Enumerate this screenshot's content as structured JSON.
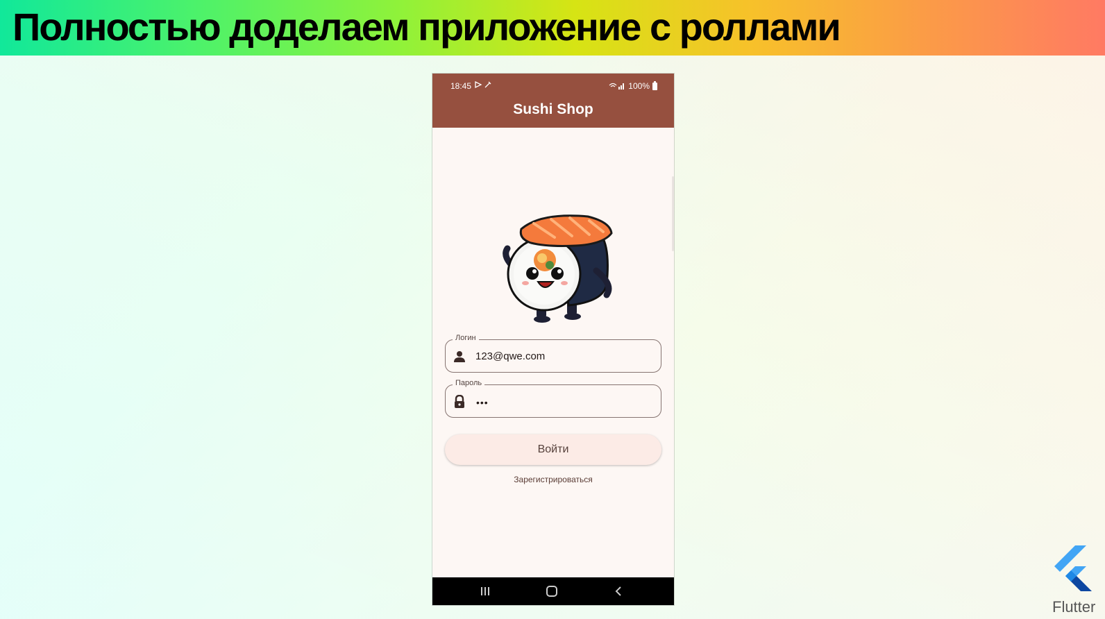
{
  "slide": {
    "title": "Полностью доделаем приложение с роллами",
    "brand_label": "Flutter"
  },
  "status_bar": {
    "time": "18:45",
    "battery": "100%"
  },
  "app": {
    "title": "Sushi Shop",
    "login_field": {
      "label": "Логин",
      "value": "123@qwe.com",
      "icon": "person-icon"
    },
    "password_field": {
      "label": "Пароль",
      "value": "•••",
      "icon": "lock-icon"
    },
    "login_button": "Войти",
    "register_link": "Зарегистрироваться"
  },
  "colors": {
    "app_bar": "#96503f",
    "background": "#fdf7f4",
    "button_bg": "#fcebe6"
  }
}
